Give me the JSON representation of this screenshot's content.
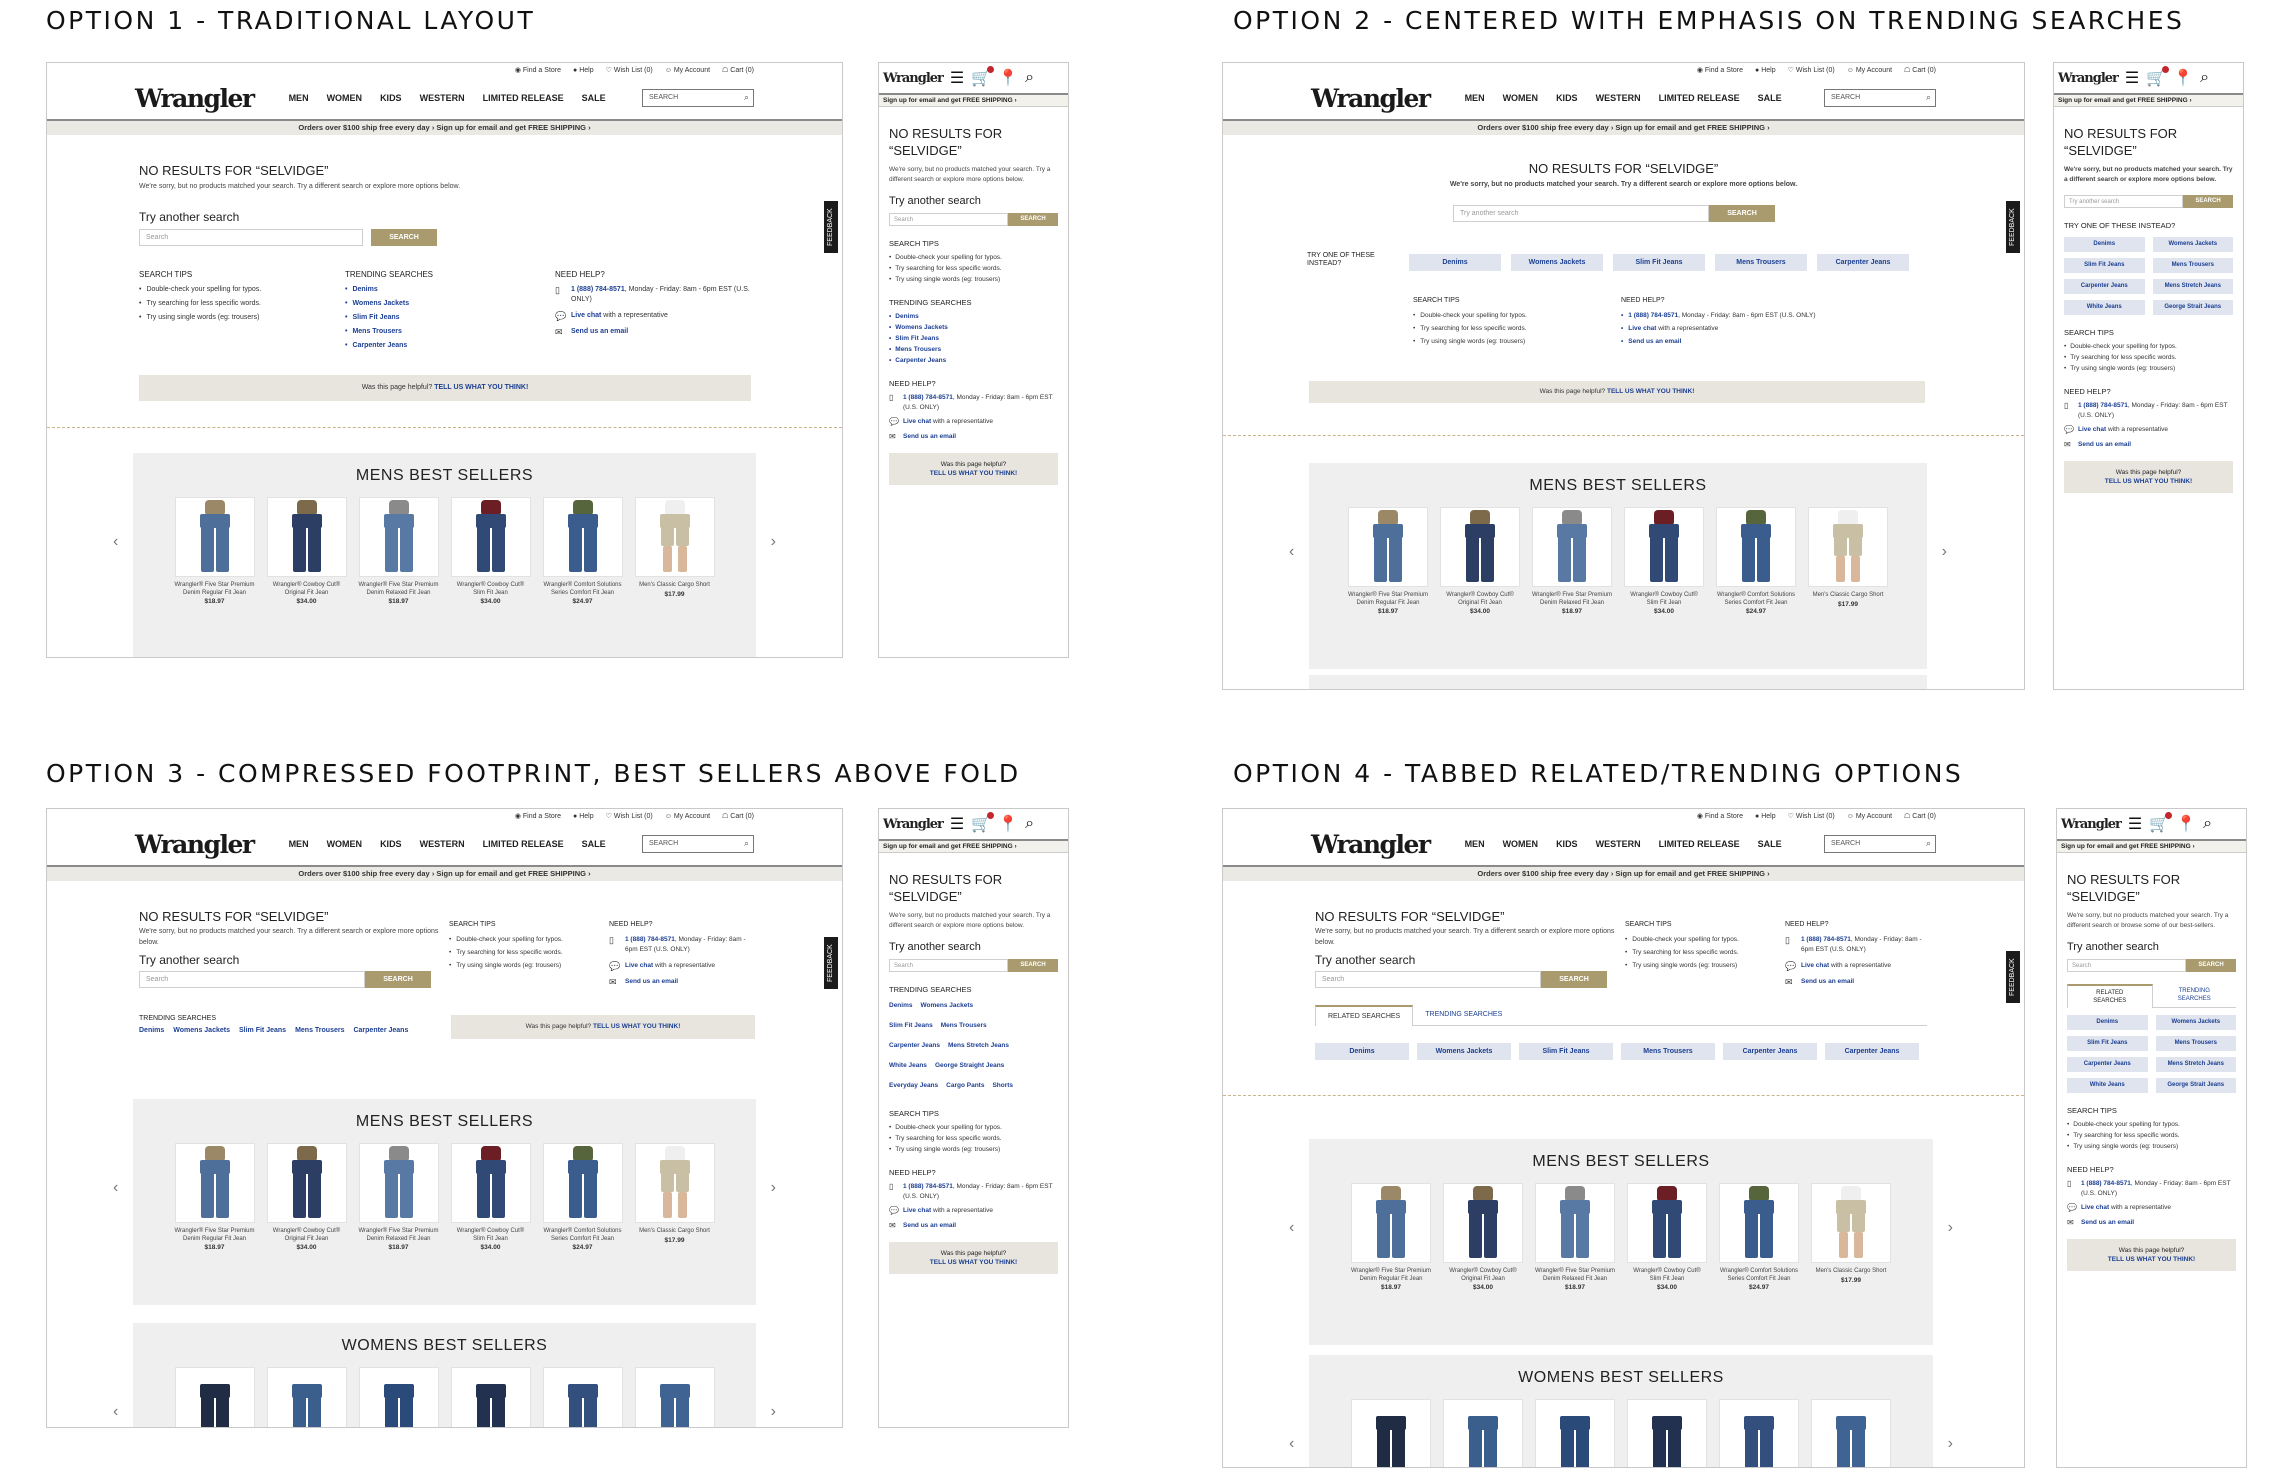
{
  "titles": {
    "o1": "OPTION 1 - TRADITIONAL LAYOUT",
    "o2": "OPTION 2 - CENTERED WITH EMPHASIS ON TRENDING SEARCHES",
    "o3": "OPTION 3 - COMPRESSED FOOTPRINT, BEST SELLERS ABOVE FOLD",
    "o4": "OPTION 4 - TABBED RELATED/TRENDING OPTIONS"
  },
  "header": {
    "util": [
      "Find a Store",
      "Help",
      "Wish List (0)",
      "My Account",
      "Cart (0)"
    ],
    "logo": "Wrangler",
    "nav": [
      "MEN",
      "WOMEN",
      "KIDS",
      "WESTERN",
      "LIMITED RELEASE",
      "SALE"
    ],
    "search_placeholder": "SEARCH",
    "promo": "Orders over $100 ship free every day  ›  Sign up for email and get FREE SHIPPING  ›",
    "mobile_promo": "Sign up for email and get FREE SHIPPING  ›"
  },
  "content": {
    "no_results": "NO RESULTS FOR “SELVIDGE”",
    "no_results_m1": "NO RESULTS FOR",
    "no_results_m2": "“SELVIDGE”",
    "sorry": "We're sorry, but no products matched your search. Try a different search or explore more options below.",
    "sorry_browse": "We're sorry, but no products matched your search. Try a different search or browse some of our best-sellers.",
    "try_another": "Try another search",
    "input_placeholder": "Search",
    "input_placeholder_alt": "Try another search",
    "search_btn": "SEARCH",
    "try_one": "TRY ONE OF THESE INSTEAD?",
    "search_tips_h": "SEARCH TIPS",
    "search_tips": [
      "Double-check your spelling for typos.",
      "Try searching for less specific words.",
      "Try using single words (eg: trousers)"
    ],
    "trending_h": "TRENDING SEARCHES",
    "trending": [
      "Denims",
      "Womens Jackets",
      "Slim Fit Jeans",
      "Mens Trousers",
      "Carpenter Jeans"
    ],
    "mobile_pills": [
      "Denims",
      "Womens Jackets",
      "Slim Fit Jeans",
      "Mens Trousers",
      "Carpenter Jeans",
      "Mens Stretch Jeans",
      "White Jeans",
      "George Strait Jeans"
    ],
    "mobile_links3": [
      [
        "Denims",
        "Womens Jackets"
      ],
      [
        "Slim Fit Jeans",
        "Mens Trousers"
      ],
      [
        "Carpenter Jeans",
        "Mens Stretch Jeans"
      ],
      [
        "White Jeans",
        "George Straight Jeans"
      ],
      [
        "Everyday Jeans",
        "Cargo Pants",
        "Shorts"
      ]
    ],
    "related_pills4": [
      "Denims",
      "Womens Jackets",
      "Slim Fit Jeans",
      "Mens Trousers",
      "Carpenter Jeans",
      "Carpenter Jeans"
    ],
    "tab_related": "RELATED SEARCHES",
    "tab_trending": "TRENDING SEARCHES",
    "tab_related_m1": "RELATED",
    "tab_related_m2": "SEARCHES",
    "tab_trending_m1": "TRENDING",
    "tab_trending_m2": "SEARCHES",
    "need_help_h": "NEED HELP?",
    "phone": "1 (888) 784-8571",
    "phone_hours": ", Monday - Friday: 8am - 6pm EST (U.S. ONLY)",
    "live_chat": "Live chat",
    "live_chat_rest": " with a representative",
    "email": "Send us an email",
    "helpful_q": "Was this page helpful?",
    "helpful_link": "TELL US WHAT YOU THINK!",
    "feedback": "FEEDBACK",
    "mens_bs": "MENS BEST SELLERS",
    "womens_bs": "WOMENS BEST SELLERS",
    "products": [
      {
        "name": "Wrangler® Five Star Premium Denim Regular Fit Jean",
        "price": "$18.97",
        "color": "#4e6f99"
      },
      {
        "name": "Wrangler® Cowboy Cut® Original Fit Jean",
        "price": "$34.00",
        "color": "#2c3e63"
      },
      {
        "name": "Wrangler® Five Star Premium Denim Relaxed Fit Jean",
        "price": "$18.97",
        "color": "#5879a3"
      },
      {
        "name": "Wrangler® Cowboy Cut® Slim Fit Jean",
        "price": "$34.00",
        "color": "#314a75"
      },
      {
        "name": "Wrangler® Comfort Solutions Series Comfort Fit Jean",
        "price": "$24.97",
        "color": "#3b5d8d"
      },
      {
        "name": "Men's Classic Cargo Short",
        "price": "$17.99",
        "color": "#c8bfa4"
      }
    ],
    "shirt_colors": [
      "#9a8866",
      "#7d6a4b",
      "#8a8a8a",
      "#6b1f25",
      "#56653b",
      "#efefef"
    ]
  }
}
